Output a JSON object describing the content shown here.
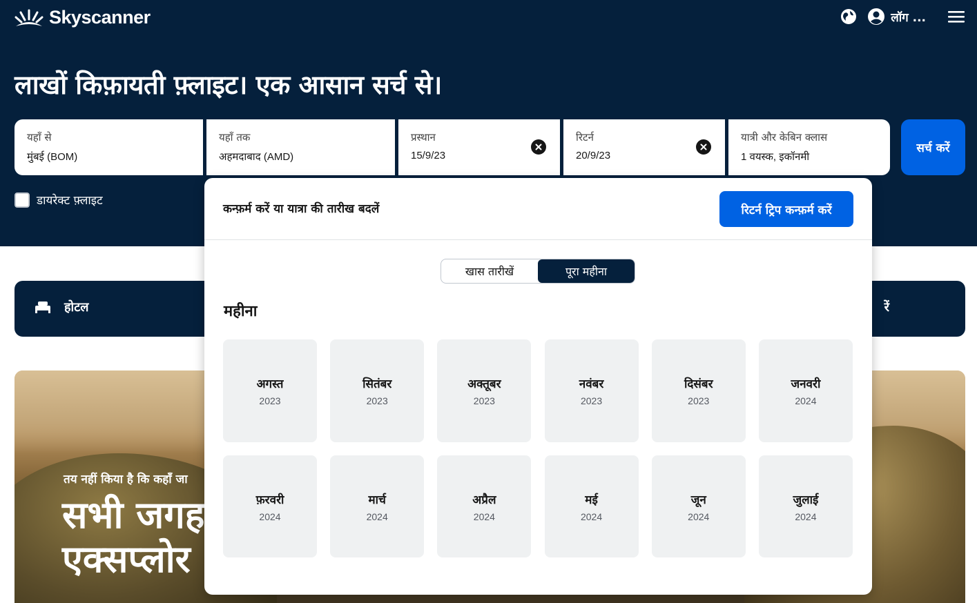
{
  "header": {
    "brand": "Skyscanner",
    "login_label": "लॉग ...",
    "icons": [
      "sunburst-logo-icon",
      "globe-icon",
      "user-icon",
      "menu-icon"
    ]
  },
  "hero": {
    "headline": "लाखों किफ़ायती फ़्लाइट। एक आसान सर्च से।"
  },
  "search": {
    "from": {
      "label": "यहाँ से",
      "value": "मुंबई (BOM)"
    },
    "to": {
      "label": "यहाँ तक",
      "value": "अहमदाबाद (AMD)"
    },
    "depart": {
      "label": "प्रस्थान",
      "value": "15/9/23"
    },
    "return": {
      "label": "रिटर्न",
      "value": "20/9/23"
    },
    "travellers": {
      "label": "यात्री और केबिन क्लास",
      "value": "1 वयस्क, इकॉनमी"
    },
    "search_button": "सर्च करें",
    "direct_label": "डायरेक्ट फ़्लाइट",
    "direct_checked": false
  },
  "categories": {
    "hotel": "होटल",
    "right_partial": "रें"
  },
  "banner": {
    "subtitle": "तय नहीं किया है कि कहाँ जा",
    "title_line1": "सभी जगह",
    "title_line2": "एक्सप्लोर"
  },
  "popup": {
    "header_text": "कन्फ़र्म करें या यात्रा की तारीख बदलें",
    "confirm_button": "रिटर्न ट्रिप कन्फ़र्म करें",
    "toggle": {
      "specific": "खास तारीखें",
      "whole_month": "पूरा महीना",
      "active": "whole_month"
    },
    "month_heading": "महीना",
    "months": [
      {
        "name": "अगस्त",
        "year": "2023"
      },
      {
        "name": "सितंबर",
        "year": "2023"
      },
      {
        "name": "अक्तूबर",
        "year": "2023"
      },
      {
        "name": "नवंबर",
        "year": "2023"
      },
      {
        "name": "दिसंबर",
        "year": "2023"
      },
      {
        "name": "जनवरी",
        "year": "2024"
      },
      {
        "name": "फ़रवरी",
        "year": "2024"
      },
      {
        "name": "मार्च",
        "year": "2024"
      },
      {
        "name": "अप्रैल",
        "year": "2024"
      },
      {
        "name": "मई",
        "year": "2024"
      },
      {
        "name": "जून",
        "year": "2024"
      },
      {
        "name": "जुलाई",
        "year": "2024"
      }
    ]
  },
  "colors": {
    "navy": "#05203c",
    "primary_blue": "#0062e3",
    "tile_bg": "#eff1f2"
  }
}
